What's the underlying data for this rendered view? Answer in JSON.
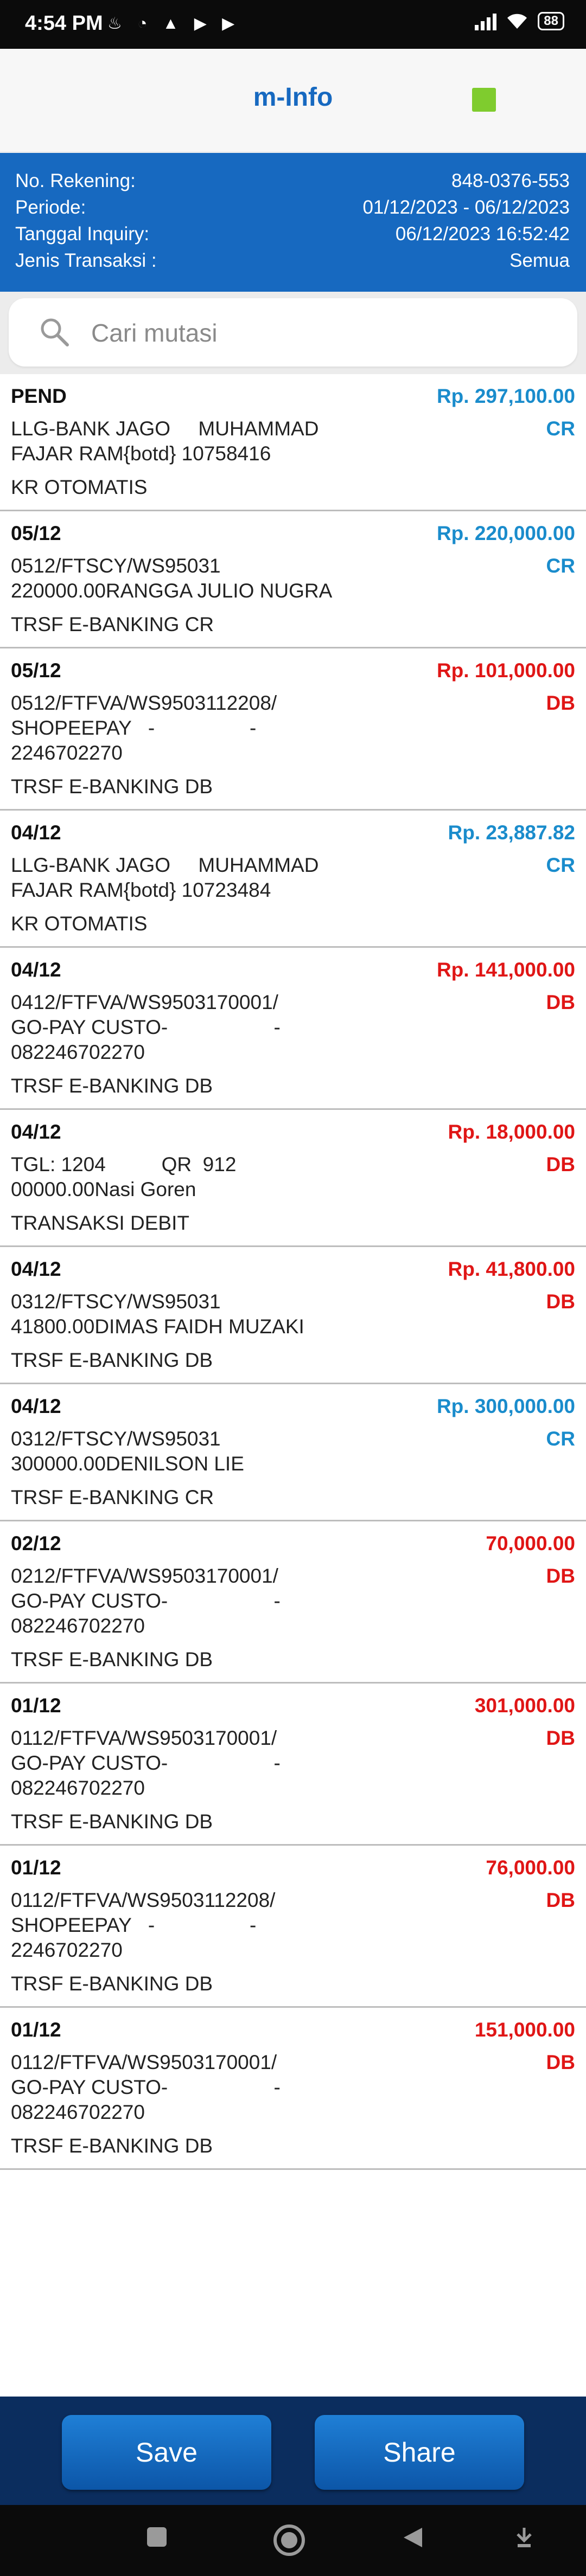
{
  "status": {
    "time": "4:54 PM",
    "notifications": "♨ ◔ ▲ ▶ ▶",
    "battery": "88"
  },
  "header": {
    "title": "m-Info"
  },
  "account": {
    "rekening_label": "No. Rekening:",
    "rekening_value": "848-0376-553",
    "periode_label": "Periode:",
    "periode_value": "01/12/2023 - 06/12/2023",
    "inquiry_label": "Tanggal Inquiry:",
    "inquiry_value": "06/12/2023 16:52:42",
    "jenis_label": "Jenis Transaksi :",
    "jenis_value": "Semua"
  },
  "search": {
    "placeholder": "Cari mutasi"
  },
  "transactions": [
    {
      "date": "PEND",
      "amount": "Rp. 297,100.00",
      "dir": "cr",
      "type": "CR",
      "desc": "LLG-BANK JAGO     MUHAMMAD\nFAJAR RAM{botd} 10758416",
      "cat": "KR OTOMATIS"
    },
    {
      "date": "05/12",
      "amount": "Rp. 220,000.00",
      "dir": "cr",
      "type": "CR",
      "desc": "0512/FTSCY/WS95031\n220000.00RANGGA JULIO NUGRA",
      "cat": "TRSF E-BANKING CR"
    },
    {
      "date": "05/12",
      "amount": "Rp. 101,000.00",
      "dir": "db",
      "type": "DB",
      "desc": "0512/FTFVA/WS9503112208/\nSHOPEEPAY   -                 -\n2246702270",
      "cat": "TRSF E-BANKING DB"
    },
    {
      "date": "04/12",
      "amount": "Rp. 23,887.82",
      "dir": "cr",
      "type": "CR",
      "desc": "LLG-BANK JAGO     MUHAMMAD\nFAJAR RAM{botd} 10723484",
      "cat": "KR OTOMATIS"
    },
    {
      "date": "04/12",
      "amount": "Rp. 141,000.00",
      "dir": "db",
      "type": "DB",
      "desc": "0412/FTFVA/WS9503170001/\nGO-PAY CUSTO-                   -\n082246702270",
      "cat": "TRSF E-BANKING DB"
    },
    {
      "date": "04/12",
      "amount": "Rp. 18,000.00",
      "dir": "db",
      "type": "DB",
      "desc": "TGL: 1204          QR  912\n00000.00Nasi Goren",
      "cat": "TRANSAKSI DEBIT"
    },
    {
      "date": "04/12",
      "amount": "Rp. 41,800.00",
      "dir": "db",
      "type": "DB",
      "desc": "0312/FTSCY/WS95031\n41800.00DIMAS FAIDH MUZAKI",
      "cat": "TRSF E-BANKING DB"
    },
    {
      "date": "04/12",
      "amount": "Rp. 300,000.00",
      "dir": "cr",
      "type": "CR",
      "desc": "0312/FTSCY/WS95031\n300000.00DENILSON LIE",
      "cat": "TRSF E-BANKING CR"
    },
    {
      "date": "02/12",
      "amount": "70,000.00",
      "dir": "db",
      "type": "DB",
      "desc": "0212/FTFVA/WS9503170001/\nGO-PAY CUSTO-                   -\n082246702270",
      "cat": "TRSF E-BANKING DB"
    },
    {
      "date": "01/12",
      "amount": "301,000.00",
      "dir": "db",
      "type": "DB",
      "desc": "0112/FTFVA/WS9503170001/\nGO-PAY CUSTO-                   -\n082246702270",
      "cat": "TRSF E-BANKING DB"
    },
    {
      "date": "01/12",
      "amount": "76,000.00",
      "dir": "db",
      "type": "DB",
      "desc": "0112/FTFVA/WS9503112208/\nSHOPEEPAY   -                 -\n2246702270",
      "cat": "TRSF E-BANKING DB"
    },
    {
      "date": "01/12",
      "amount": "151,000.00",
      "dir": "db",
      "type": "DB",
      "desc": "0112/FTFVA/WS9503170001/\nGO-PAY CUSTO-                   -\n082246702270",
      "cat": "TRSF E-BANKING DB"
    }
  ],
  "actions": {
    "save_label": "Save",
    "share_label": "Share"
  },
  "colors": {
    "brand_blue": "#1769c0",
    "credit": "#1a8ccc",
    "debit": "#e01616",
    "status_green": "#7fcc2e",
    "bottom_bar": "#0b2d5e"
  }
}
